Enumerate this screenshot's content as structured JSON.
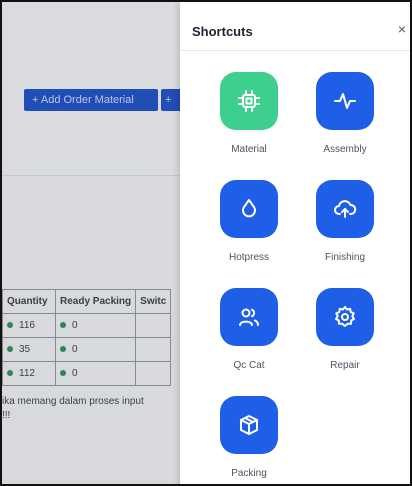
{
  "background": {
    "add_order_button": "+ Add Order Material",
    "add_second_button": "+",
    "table_headers": [
      "Quantity",
      "Ready Packing",
      "Switc"
    ],
    "rows": [
      {
        "quantity": "116",
        "ready_packing": "0"
      },
      {
        "quantity": "35",
        "ready_packing": "0"
      },
      {
        "quantity": "112",
        "ready_packing": "0"
      }
    ],
    "note_line1": "ika memang dalam proses input",
    "note_line2": "!!!"
  },
  "panel": {
    "title": "Shortcuts",
    "close_label": "×",
    "shortcuts": [
      {
        "label": "Material",
        "icon": "chip-icon",
        "color": "#3ecf8e"
      },
      {
        "label": "Assembly",
        "icon": "activity-icon",
        "color": "#1f5fe8"
      },
      {
        "label": "Hotpress",
        "icon": "droplet-icon",
        "color": "#1f5fe8"
      },
      {
        "label": "Finishing",
        "icon": "cloud-upload-icon",
        "color": "#1f5fe8"
      },
      {
        "label": "Qc Cat",
        "icon": "users-icon",
        "color": "#1f5fe8"
      },
      {
        "label": "Repair",
        "icon": "gear-icon",
        "color": "#1f5fe8"
      },
      {
        "label": "Packing",
        "icon": "package-icon",
        "color": "#1f5fe8"
      }
    ]
  }
}
